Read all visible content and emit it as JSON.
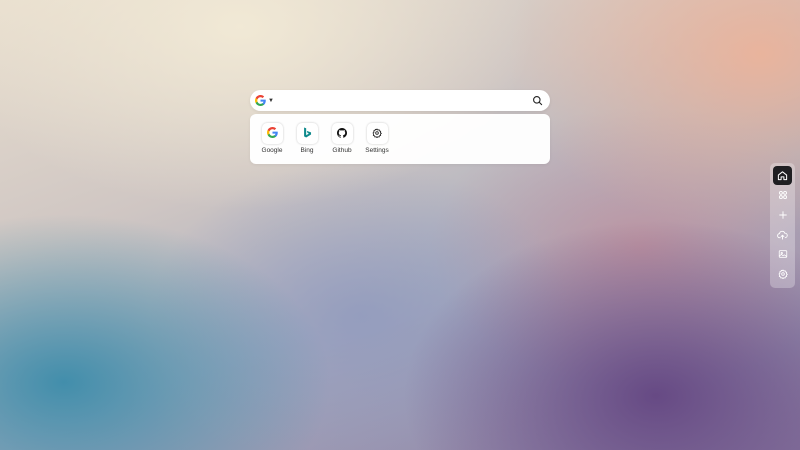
{
  "search": {
    "engine_icon": "google-g-icon",
    "value": "",
    "placeholder": ""
  },
  "shortcuts": [
    {
      "label": "Google",
      "icon": "google-icon"
    },
    {
      "label": "Bing",
      "icon": "bing-icon"
    },
    {
      "label": "Github",
      "icon": "github-icon"
    },
    {
      "label": "Settings",
      "icon": "gear-icon"
    }
  ],
  "dock": [
    {
      "icon": "home-icon",
      "active": true
    },
    {
      "icon": "apps-icon",
      "active": false
    },
    {
      "icon": "plus-icon",
      "active": false
    },
    {
      "icon": "cloud-upload-icon",
      "active": false
    },
    {
      "icon": "image-icon",
      "active": false
    },
    {
      "icon": "gear-icon",
      "active": false
    }
  ],
  "colors": {
    "google_blue": "#4285F4",
    "google_red": "#EA4335",
    "google_yellow": "#FBBC05",
    "google_green": "#34A853",
    "bing_teal": "#0f8a8c",
    "dock_active": "#1f1f22"
  }
}
